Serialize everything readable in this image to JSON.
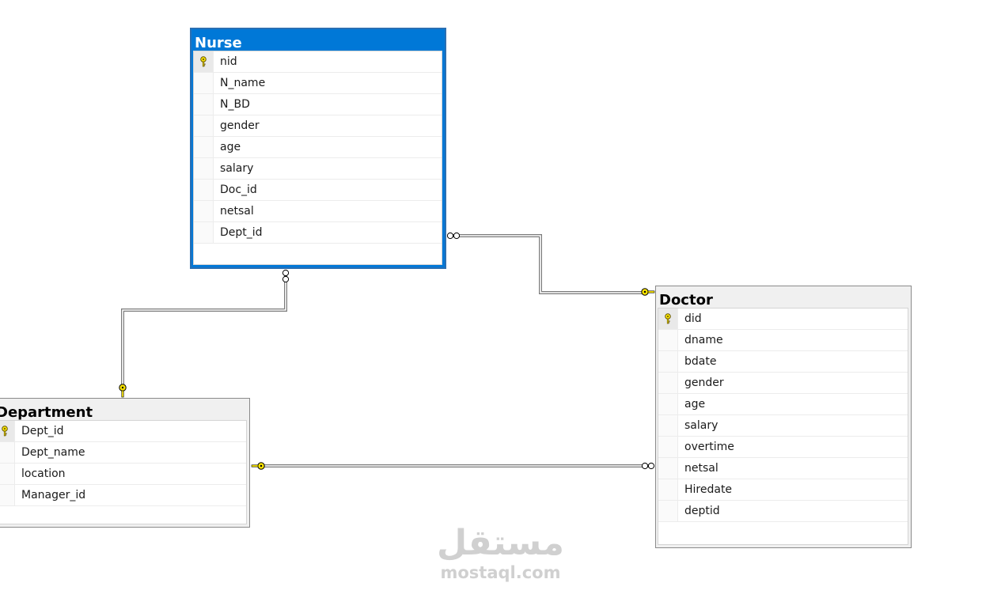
{
  "diagram": {
    "tables": [
      {
        "name": "Nurse",
        "selected": true,
        "columns": [
          {
            "name": "nid",
            "pk": true
          },
          {
            "name": "N_name",
            "pk": false
          },
          {
            "name": "N_BD",
            "pk": false
          },
          {
            "name": "gender",
            "pk": false
          },
          {
            "name": "age",
            "pk": false
          },
          {
            "name": "salary",
            "pk": false
          },
          {
            "name": "Doc_id",
            "pk": false
          },
          {
            "name": "netsal",
            "pk": false
          },
          {
            "name": "Dept_id",
            "pk": false
          }
        ]
      },
      {
        "name": "Department",
        "selected": false,
        "columns": [
          {
            "name": "Dept_id",
            "pk": true
          },
          {
            "name": "Dept_name",
            "pk": false
          },
          {
            "name": "location",
            "pk": false
          },
          {
            "name": "Manager_id",
            "pk": false
          }
        ]
      },
      {
        "name": "Doctor",
        "selected": false,
        "columns": [
          {
            "name": "did",
            "pk": true
          },
          {
            "name": "dname",
            "pk": false
          },
          {
            "name": "bdate",
            "pk": false
          },
          {
            "name": "gender",
            "pk": false
          },
          {
            "name": "age",
            "pk": false
          },
          {
            "name": "salary",
            "pk": false
          },
          {
            "name": "overtime",
            "pk": false
          },
          {
            "name": "netsal",
            "pk": false
          },
          {
            "name": "Hiredate",
            "pk": false
          },
          {
            "name": "deptid",
            "pk": false
          }
        ]
      }
    ],
    "relationships": [
      {
        "from": "Nurse",
        "to": "Doctor",
        "one_end": "Doctor",
        "many_end": "Nurse"
      },
      {
        "from": "Nurse",
        "to": "Department",
        "one_end": "Department",
        "many_end": "Nurse"
      },
      {
        "from": "Doctor",
        "to": "Department",
        "one_end": "Department",
        "many_end": "Doctor"
      }
    ]
  },
  "colors": {
    "selected_title_bg": "#0078d7",
    "title_bg": "#f0f0f0",
    "key_icon": "#f5e100",
    "connector": "#7a7a7a"
  },
  "icons": {
    "primary_key": "key-icon",
    "one_end": "key-icon",
    "many_end": "infinity-icon"
  },
  "watermark": {
    "arabic": "مستقل",
    "latin": "mostaql.com"
  }
}
